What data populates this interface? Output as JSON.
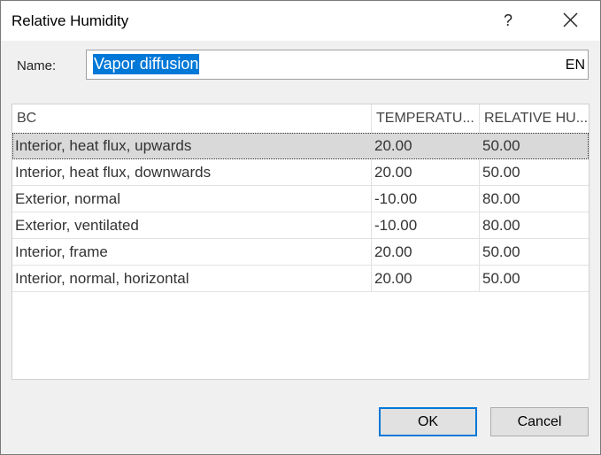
{
  "window": {
    "title": "Relative Humidity",
    "help_label": "?"
  },
  "name_field": {
    "label": "Name:",
    "value": "Vapor diffusion",
    "language": "EN"
  },
  "table": {
    "columns": [
      "BC",
      "TEMPERATU...",
      "RELATIVE HU..."
    ],
    "rows": [
      [
        "Interior, heat flux, upwards",
        "20.00",
        "50.00"
      ],
      [
        "Interior, heat flux, downwards",
        "20.00",
        "50.00"
      ],
      [
        "Exterior, normal",
        "-10.00",
        "80.00"
      ],
      [
        "Exterior, ventilated",
        "-10.00",
        "80.00"
      ],
      [
        "Interior, frame",
        "20.00",
        "50.00"
      ],
      [
        "Interior, normal, horizontal",
        "20.00",
        "50.00"
      ]
    ],
    "selected_row": 0
  },
  "buttons": {
    "ok": "OK",
    "cancel": "Cancel"
  },
  "colors": {
    "selection": "#0078d7",
    "row_selected": "#d9d9d9"
  }
}
